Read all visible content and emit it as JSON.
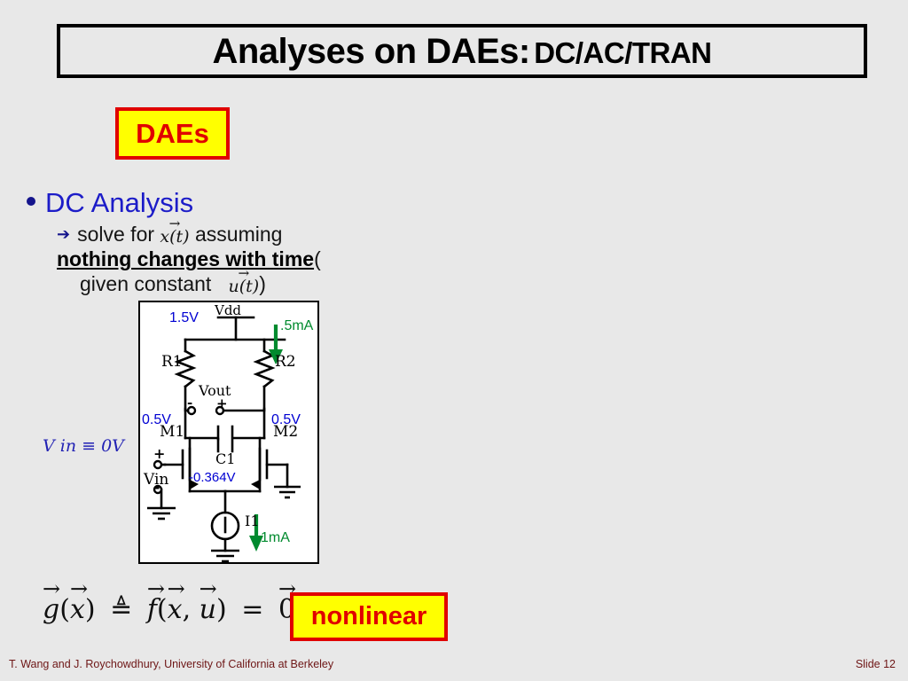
{
  "slide": {
    "title_main": "Analyses on DAEs:",
    "title_sub": "DC/AC/TRAN",
    "tag_daes": "DAEs",
    "tag_nonlinear": "nonlinear"
  },
  "bullets": {
    "level1": "DC Analysis",
    "sub_arrow": "➔",
    "sub_line1_a": "solve for",
    "sub_line1_math": "x(t)",
    "sub_line1_b": "assuming",
    "sub_line2_emph": "nothing changes with time",
    "sub_line2_paren": "(",
    "sub_line3_a": "given constant",
    "sub_line3_math": "u(t)",
    "sub_line3_close": ")"
  },
  "equation": {
    "g": "g",
    "x1": "x",
    "triangleq": "≜",
    "f": "f",
    "x2": "x",
    "comma": ",",
    "u": "u",
    "equals": "=",
    "zero": "0"
  },
  "circuit": {
    "vin_label": "V in ≡ 0V",
    "labels": {
      "vdd": "Vdd",
      "vdd_voltage": "1.5V",
      "r1": "R1",
      "r2": "R2",
      "vout": "Vout",
      "vout_minus": "-",
      "vout_plus": "+",
      "node_left_voltage": "0.5V",
      "node_right_voltage": "0.5V",
      "current_r2": ".5mA",
      "m1": "M1",
      "m2": "M2",
      "c1": "C1",
      "tail_voltage": "-0.364V",
      "vin": "Vin",
      "vin_plus": "+",
      "vin_minus": "-",
      "i1": "I1",
      "current_i1": "1mA"
    },
    "colors": {
      "voltage": "#0000d2",
      "current": "#008a2e",
      "wire": "#000000",
      "panel_bg": "#ffffff"
    }
  },
  "footer": {
    "left": "T. Wang  and J. Roychowdhury,  University  of California  at Berkeley",
    "right": "Slide 12"
  },
  "theme": {
    "background": "#e8e8e8",
    "accent_blue": "#1c1cc8",
    "accent_red": "#e00000",
    "highlight_yellow": "#ffff00",
    "footer_color": "#6e1616"
  }
}
